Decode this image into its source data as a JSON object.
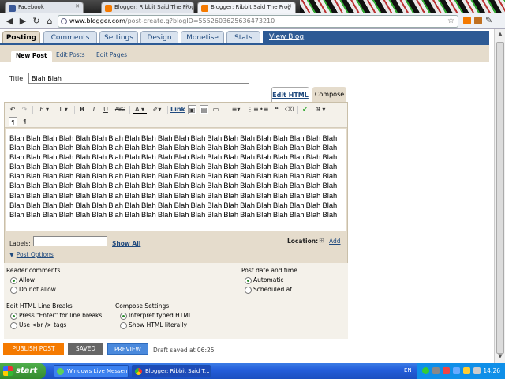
{
  "browser": {
    "tabs": [
      {
        "label": "Facebook",
        "color": "#3b5998"
      },
      {
        "label": "Blogger: Ribbit Said The Frog",
        "color": "#f57a00"
      },
      {
        "label": "Blogger: Ribbit Said The Frog",
        "color": "#f57a00"
      }
    ],
    "url_host": "www.blogger.com",
    "url_path": "/post-create.g?blogID=5552603625636473210"
  },
  "blogger_nav": {
    "tabs": [
      "Posting",
      "Comments",
      "Settings",
      "Design",
      "Monetise",
      "Stats"
    ],
    "view_blog": "View Blog"
  },
  "sub_nav": [
    "New Post",
    "Edit Posts",
    "Edit Pages"
  ],
  "editor": {
    "title_label": "Title:",
    "title_value": "Blah Blah",
    "mode_html": "Edit HTML",
    "mode_compose": "Compose",
    "toolbar": {
      "font": "F",
      "size": "T",
      "bold": "B",
      "italic": "I",
      "underline": "U",
      "strike": "ABC",
      "text_color": "A",
      "link": "Link",
      "translit": "अ"
    },
    "body_lines": [
      "Blah Blah Blah Blah Blah Blah Blah Blah Blah Blah Blah Blah Blah Blah Blah Blah Blah Blah Blah Blah",
      "Blah Blah Blah Blah Blah Blah Blah Blah Blah Blah Blah Blah Blah Blah Blah Blah Blah Blah Blah Blah",
      "Blah Blah Blah Blah Blah Blah Blah Blah Blah Blah Blah Blah Blah Blah Blah Blah Blah Blah Blah Blah",
      "Blah Blah Blah Blah Blah Blah Blah Blah Blah Blah Blah Blah Blah Blah Blah Blah Blah Blah Blah Blah",
      "Blah Blah Blah Blah Blah Blah Blah Blah Blah Blah Blah Blah Blah Blah Blah Blah Blah Blah Blah Blah",
      "Blah Blah Blah Blah Blah Blah Blah Blah Blah Blah Blah Blah Blah Blah Blah Blah Blah Blah Blah Blah",
      "Blah Blah Blah Blah Blah Blah Blah Blah Blah Blah Blah Blah Blah Blah Blah Blah Blah Blah Blah Blah",
      "Blah Blah Blah Blah Blah Blah Blah Blah Blah Blah Blah Blah Blah Blah Blah Blah Blah Blah Blah Blah",
      "Blah Blah Blah Blah Blah Blah Blah Blah Blah Blah Blah Blah Blah Blah Blah Blah Blah Blah Blah Blah"
    ],
    "labels_label": "Labels:",
    "show_all": "Show All",
    "location_label": "Location:",
    "location_add": "Add",
    "post_options": "Post Options"
  },
  "options": {
    "reader_comments": {
      "heading": "Reader comments",
      "allow": "Allow",
      "deny": "Do not allow"
    },
    "post_date": {
      "heading": "Post date and time",
      "automatic": "Automatic",
      "scheduled": "Scheduled at"
    },
    "line_breaks": {
      "heading": "Edit HTML Line Breaks",
      "enter": "Press \"Enter\" for line breaks",
      "br": "Use <br /> tags"
    },
    "compose": {
      "heading": "Compose Settings",
      "interpret": "Interpret typed HTML",
      "literal": "Show HTML literally"
    }
  },
  "actions": {
    "publish": "PUBLISH POST",
    "saved": "SAVED",
    "preview": "PREVIEW",
    "draft": "Draft saved at 06:25"
  },
  "taskbar": {
    "start": "start",
    "items": [
      "Windows Live Messen...",
      "Blogger: Ribbit Said T..."
    ],
    "lang": "EN",
    "clock": "14:26"
  }
}
